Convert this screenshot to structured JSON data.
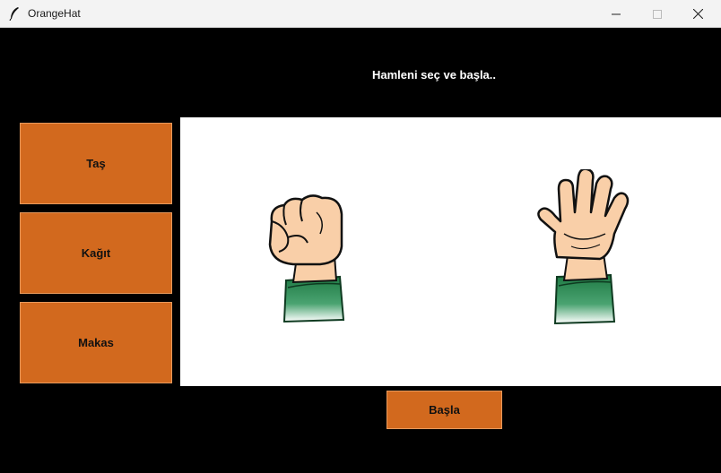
{
  "window": {
    "title": "OrangeHat",
    "icon": "feather-icon",
    "controls": [
      "minimize-icon",
      "maximize-icon",
      "close-icon"
    ]
  },
  "prompt": "Hamleni seç ve başla..",
  "moves": [
    {
      "label": "Taş"
    },
    {
      "label": "Kağıt"
    },
    {
      "label": "Makas"
    }
  ],
  "arena": {
    "player_hand": "rock-hand-icon",
    "computer_hand": "paper-hand-icon"
  },
  "start_button": "Başla",
  "colors": {
    "button_bg": "#d2691e",
    "window_bg": "#000000",
    "arena_bg": "#ffffff",
    "sleeve": "#2e8b57",
    "skin": "#f9cfa8"
  }
}
